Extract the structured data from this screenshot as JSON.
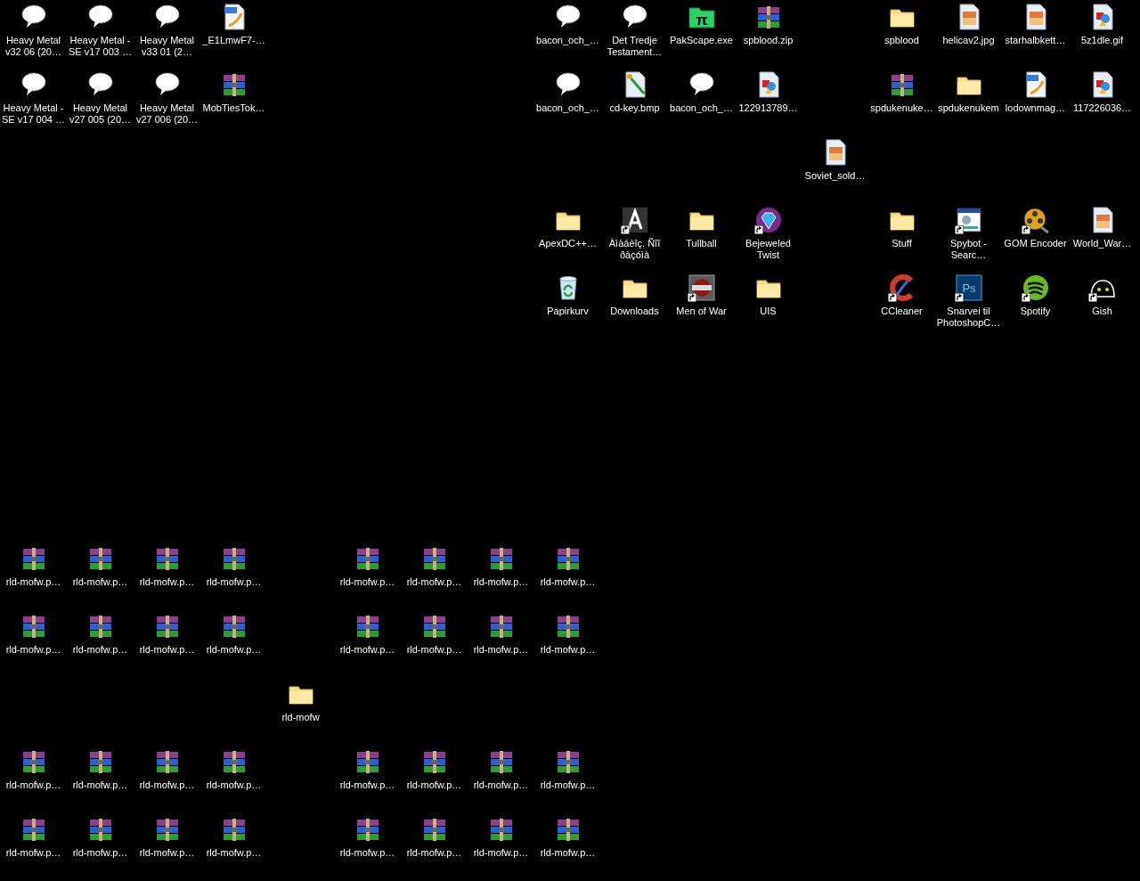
{
  "desktop": {
    "icons": [
      {
        "kind": "speech",
        "label": "Heavy Metal v32 06 (20…",
        "shortcut": false
      },
      {
        "kind": "speech",
        "label": "Heavy Metal - SE v17 003 …",
        "shortcut": false
      },
      {
        "kind": "speech",
        "label": "Heavy Metal v33 01 (2…",
        "shortcut": false
      },
      {
        "kind": "pdf",
        "label": "_E1LmwF7-…",
        "shortcut": false
      },
      {
        "kind": "speech",
        "label": "bacon_och_…",
        "shortcut": false
      },
      {
        "kind": "speech",
        "label": "Det Tredje Testament…",
        "shortcut": false
      },
      {
        "kind": "pi",
        "glyph": "π",
        "label": "PakScape.exe",
        "shortcut": false
      },
      {
        "kind": "archive",
        "label": "spblood.zip",
        "shortcut": false
      },
      {
        "kind": "folder",
        "label": "spblood",
        "shortcut": false
      },
      {
        "kind": "photo",
        "label": "helicav2.jpg",
        "shortcut": false
      },
      {
        "kind": "photo",
        "label": "starhalbkett…",
        "shortcut": false
      },
      {
        "kind": "image",
        "label": "5z1dle.gif",
        "shortcut": false
      },
      {
        "kind": "speech",
        "label": "Heavy Metal - SE v17 004 …",
        "shortcut": false
      },
      {
        "kind": "speech",
        "label": "Heavy Metal v27 005 (20…",
        "shortcut": false
      },
      {
        "kind": "speech",
        "label": "Heavy Metal v27 006 (20…",
        "shortcut": false
      },
      {
        "kind": "archive",
        "label": "MobTiesTok…",
        "shortcut": false
      },
      {
        "kind": "speech",
        "label": "bacon_och_…",
        "shortcut": false
      },
      {
        "kind": "paint",
        "label": "cd-key.bmp",
        "shortcut": false
      },
      {
        "kind": "speech",
        "label": "bacon_och_…",
        "shortcut": false
      },
      {
        "kind": "image",
        "label": "122913789…",
        "shortcut": false
      },
      {
        "kind": "archive",
        "label": "spdukenuke…",
        "shortcut": false
      },
      {
        "kind": "folder",
        "label": "spdukenukem",
        "shortcut": false
      },
      {
        "kind": "pdf",
        "label": "lodownmag…",
        "shortcut": false
      },
      {
        "kind": "image",
        "label": "117226036…",
        "shortcut": false
      },
      {
        "kind": "photo",
        "label": "Soviet_sold…",
        "shortcut": false
      },
      {
        "kind": "folder",
        "label": "ApexDC++…",
        "shortcut": false
      },
      {
        "kind": "letter",
        "label": "Àìàáèîç. Ñîî ðàçóìà",
        "shortcut": true
      },
      {
        "kind": "folder",
        "label": "Tullball",
        "shortcut": false
      },
      {
        "kind": "gem",
        "label": "Bejeweled Twist",
        "shortcut": true
      },
      {
        "kind": "folder",
        "label": "Stuff",
        "shortcut": false
      },
      {
        "kind": "window",
        "label": "Spybot - Searc…",
        "shortcut": true
      },
      {
        "kind": "reel",
        "label": "GOM Encoder",
        "shortcut": true
      },
      {
        "kind": "photo",
        "label": "World_War…",
        "shortcut": false
      },
      {
        "kind": "recycle",
        "label": "Papirkurv",
        "shortcut": false
      },
      {
        "kind": "folder",
        "label": "Downloads",
        "shortcut": false
      },
      {
        "kind": "game",
        "label": "Men of War",
        "shortcut": true
      },
      {
        "kind": "folder",
        "label": "UIS",
        "shortcut": false
      },
      {
        "kind": "cleaner",
        "label": "CCleaner",
        "shortcut": true
      },
      {
        "kind": "ps",
        "glyph": "Ps",
        "label": "Snarvei til PhotoshopC…",
        "shortcut": true
      },
      {
        "kind": "spotify",
        "label": "Spotify",
        "shortcut": true
      },
      {
        "kind": "blob",
        "label": "Gish",
        "shortcut": true
      },
      {
        "kind": "archive",
        "label": "rld-mofw.p…",
        "shortcut": false
      },
      {
        "kind": "archive",
        "label": "rld-mofw.p…",
        "shortcut": false
      },
      {
        "kind": "archive",
        "label": "rld-mofw.p…",
        "shortcut": false
      },
      {
        "kind": "archive",
        "label": "rld-mofw.p…",
        "shortcut": false
      },
      {
        "kind": "archive",
        "label": "rld-mofw.p…",
        "shortcut": false
      },
      {
        "kind": "archive",
        "label": "rld-mofw.p…",
        "shortcut": false
      },
      {
        "kind": "archive",
        "label": "rld-mofw.p…",
        "shortcut": false
      },
      {
        "kind": "archive",
        "label": "rld-mofw.p…",
        "shortcut": false
      },
      {
        "kind": "archive",
        "label": "rld-mofw.p…",
        "shortcut": false
      },
      {
        "kind": "archive",
        "label": "rld-mofw.p…",
        "shortcut": false
      },
      {
        "kind": "archive",
        "label": "rld-mofw.p…",
        "shortcut": false
      },
      {
        "kind": "archive",
        "label": "rld-mofw.p…",
        "shortcut": false
      },
      {
        "kind": "archive",
        "label": "rld-mofw.p…",
        "shortcut": false
      },
      {
        "kind": "archive",
        "label": "rld-mofw.p…",
        "shortcut": false
      },
      {
        "kind": "archive",
        "label": "rld-mofw.p…",
        "shortcut": false
      },
      {
        "kind": "archive",
        "label": "rld-mofw.p…",
        "shortcut": false
      },
      {
        "kind": "folder",
        "label": "rld-mofw",
        "shortcut": false
      },
      {
        "kind": "archive",
        "label": "rld-mofw.p…",
        "shortcut": false
      },
      {
        "kind": "archive",
        "label": "rld-mofw.p…",
        "shortcut": false
      },
      {
        "kind": "archive",
        "label": "rld-mofw.p…",
        "shortcut": false
      },
      {
        "kind": "archive",
        "label": "rld-mofw.p…",
        "shortcut": false
      },
      {
        "kind": "archive",
        "label": "rld-mofw.p…",
        "shortcut": false
      },
      {
        "kind": "archive",
        "label": "rld-mofw.p…",
        "shortcut": false
      },
      {
        "kind": "archive",
        "label": "rld-mofw.p…",
        "shortcut": false
      },
      {
        "kind": "archive",
        "label": "rld-mofw.p…",
        "shortcut": false
      },
      {
        "kind": "archive",
        "label": "rld-mofw.p…",
        "shortcut": false
      },
      {
        "kind": "archive",
        "label": "rld-mofw.p…",
        "shortcut": false
      },
      {
        "kind": "archive",
        "label": "rld-mofw.p…",
        "shortcut": false
      },
      {
        "kind": "archive",
        "label": "rld-mofw.p…",
        "shortcut": false
      },
      {
        "kind": "archive",
        "label": "rld-mofw.p…",
        "shortcut": false
      },
      {
        "kind": "archive",
        "label": "rld-mofw.p…",
        "shortcut": false
      },
      {
        "kind": "archive",
        "label": "rld-mofw.p…",
        "shortcut": false
      },
      {
        "kind": "archive",
        "label": "rld-mofw.p…",
        "shortcut": false
      }
    ]
  }
}
